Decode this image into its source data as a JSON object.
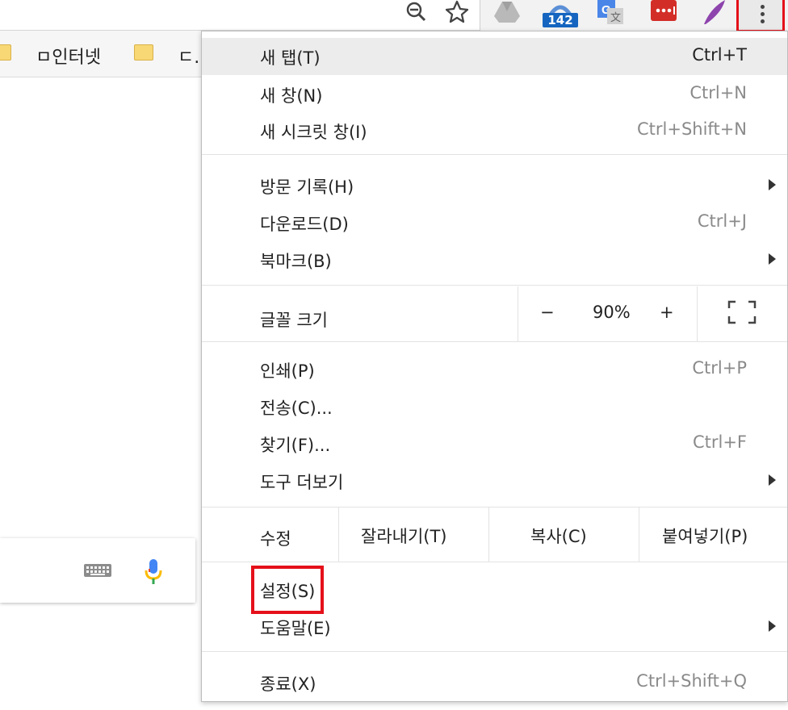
{
  "toolbar": {
    "extension_badge": "142",
    "icons": [
      "zoom-out-icon",
      "star-icon",
      "google-drive-icon",
      "weather-icon",
      "google-translate-icon",
      "lastpass-icon",
      "quill-icon",
      "menu-kebab-icon"
    ]
  },
  "bookmarks": {
    "items": [
      {
        "label": "ㅁ인터넷"
      },
      {
        "label": "ㄷ..."
      }
    ]
  },
  "menu": {
    "new_tab": {
      "label": "새 탭(T)",
      "shortcut": "Ctrl+T"
    },
    "new_window": {
      "label": "새 창(N)",
      "shortcut": "Ctrl+N"
    },
    "new_incognito": {
      "label": "새 시크릿 창(I)",
      "shortcut": "Ctrl+Shift+N"
    },
    "history": {
      "label": "방문 기록(H)"
    },
    "downloads": {
      "label": "다운로드(D)",
      "shortcut": "Ctrl+J"
    },
    "bookmarks": {
      "label": "북마크(B)"
    },
    "zoom": {
      "label": "글꼴 크기",
      "minus": "−",
      "value": "90%",
      "plus": "+"
    },
    "print": {
      "label": "인쇄(P)",
      "shortcut": "Ctrl+P"
    },
    "cast": {
      "label": "전송(C)..."
    },
    "find": {
      "label": "찾기(F)...",
      "shortcut": "Ctrl+F"
    },
    "more_tools": {
      "label": "도구 더보기"
    },
    "edit": {
      "label": "수정",
      "cut": "잘라내기(T)",
      "copy": "복사(C)",
      "paste": "붙여넣기(P)"
    },
    "settings": {
      "label": "설정(S)"
    },
    "help": {
      "label": "도움말(E)"
    },
    "exit": {
      "label": "종료(X)",
      "shortcut": "Ctrl+Shift+Q"
    }
  },
  "colors": {
    "highlight": "#e5101a",
    "menu_hover": "#ececec",
    "shortcut_text": "#8a8a8a"
  }
}
